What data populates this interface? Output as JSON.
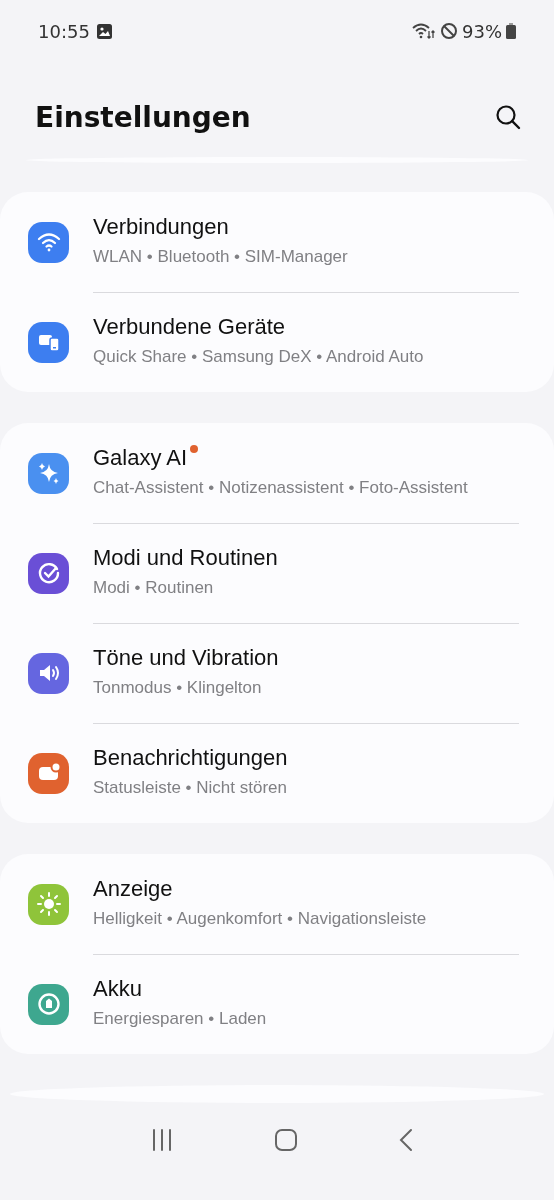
{
  "status_bar": {
    "time": "10:55",
    "battery": "93%"
  },
  "header": {
    "title": "Einstellungen"
  },
  "groups": [
    {
      "items": [
        {
          "kind": "wifi",
          "color": "#3d7ef0",
          "title": "Verbindungen",
          "subtitle": "WLAN • Bluetooth • SIM-Manager",
          "badge": false
        },
        {
          "kind": "devices",
          "color": "#3d7ef0",
          "title": "Verbundene Geräte",
          "subtitle": "Quick Share • Samsung DeX • Android Auto",
          "badge": false
        }
      ]
    },
    {
      "items": [
        {
          "kind": "sparkle",
          "color": "#4a90f0",
          "title": "Galaxy AI",
          "subtitle": "Chat-Assistent • Notizenassistent • Foto-Assistent",
          "badge": true
        },
        {
          "kind": "check",
          "color": "#6a4fd6",
          "title": "Modi und Routinen",
          "subtitle": "Modi • Routinen",
          "badge": false
        },
        {
          "kind": "sound",
          "color": "#6566e0",
          "title": "Töne und Vibration",
          "subtitle": "Tonmodus • Klingelton",
          "badge": false
        },
        {
          "kind": "notification",
          "color": "#e0622f",
          "title": "Benachrichtigungen",
          "subtitle": "Statusleiste • Nicht stören",
          "badge": false
        }
      ]
    },
    {
      "items": [
        {
          "kind": "sun",
          "color": "#8fc43a",
          "title": "Anzeige",
          "subtitle": "Helligkeit • Augenkomfort • Navigationsleiste",
          "badge": false
        },
        {
          "kind": "battery",
          "color": "#3ea78f",
          "title": "Akku",
          "subtitle": "Energiesparen • Laden",
          "badge": false
        }
      ]
    }
  ]
}
